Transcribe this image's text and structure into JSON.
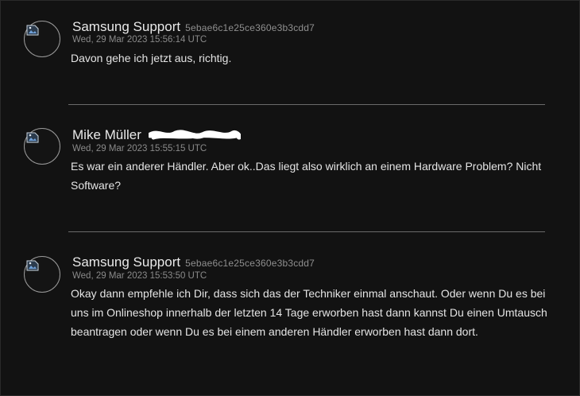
{
  "messages": [
    {
      "author": "Samsung Support",
      "user_id": "5ebae6c1e25ce360e3b3cdd7",
      "timestamp": "Wed, 29 Mar 2023 15:56:14 UTC",
      "text": "Davon gehe ich jetzt aus, richtig."
    },
    {
      "author": "Mike Müller",
      "user_id": "",
      "timestamp": "Wed, 29 Mar 2023 15:55:15 UTC",
      "text": "Es war ein anderer Händler. Aber ok..Das liegt also wirklich an einem Hardware Problem? Nicht Software?"
    },
    {
      "author": "Samsung Support",
      "user_id": "5ebae6c1e25ce360e3b3cdd7",
      "timestamp": "Wed, 29 Mar 2023 15:53:50 UTC",
      "text": "Okay dann empfehle ich Dir, dass sich das der Techniker einmal anschaut. Oder wenn Du es bei uns im Onlineshop innerhalb der letzten 14 Tage erworben hast dann kannst Du einen Umtausch beantragen oder wenn Du es bei einem anderen Händler erworben hast dann dort."
    }
  ],
  "icons": {
    "avatar": "broken-image-icon",
    "redaction": "redacted-scribble"
  },
  "colors": {
    "background": "#121212",
    "text": "#e4e4e4",
    "meta": "#8a8a8a",
    "divider": "#6a6a6a"
  }
}
